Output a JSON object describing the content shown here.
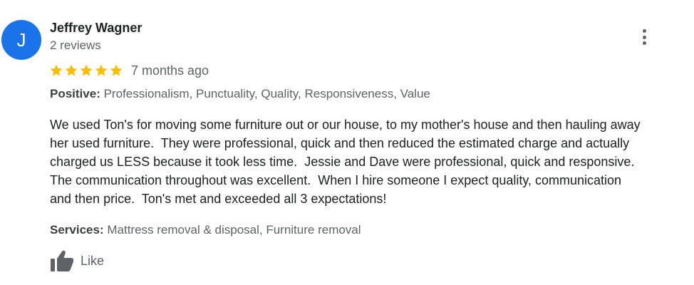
{
  "review": {
    "avatar_letter": "J",
    "avatar_color": "#1a73e8",
    "reviewer_name": "Jeffrey Wagner",
    "review_count": "2 reviews",
    "rating": 5,
    "rating_max": 5,
    "star_color": "#fbbc04",
    "time_ago": "7 months ago",
    "positive": {
      "label": "Positive:",
      "value": "Professionalism, Punctuality, Quality, Responsiveness, Value"
    },
    "text_lines": [
      "We used Ton's for moving some furniture out or our house, to my mother's house and then hauling away",
      "her used furniture.  They were professional, quick and then reduced the estimated charge and actually",
      "charged us LESS because it took less time.  Jessie and Dave were professional, quick and responsive.",
      "The communication throughout was excellent.  When I hire someone I expect quality, communication",
      "and then price.  Ton's met and exceeded all 3 expectations!"
    ],
    "services": {
      "label": "Services:",
      "value": "Mattress removal & disposal, Furniture removal"
    },
    "like_label": "Like"
  },
  "icons": {
    "menu": "more-vertical-icon",
    "star": "star-icon",
    "like": "thumbs-up-icon"
  }
}
